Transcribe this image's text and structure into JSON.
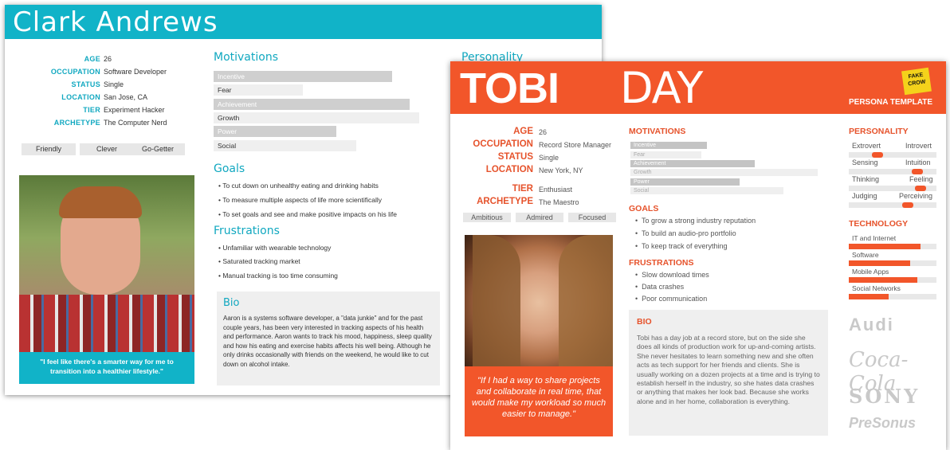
{
  "clark": {
    "name": "Clark Andrews",
    "details": [
      {
        "label": "AGE",
        "value": "26"
      },
      {
        "label": "OCCUPATION",
        "value": "Software Developer"
      },
      {
        "label": "STATUS",
        "value": "Single"
      },
      {
        "label": "LOCATION",
        "value": "San Jose, CA"
      },
      {
        "label": "TIER",
        "value": "Experiment Hacker"
      },
      {
        "label": "ARCHETYPE",
        "value": "The Computer Nerd"
      }
    ],
    "traits": [
      "Friendly",
      "Clever",
      "Go-Getter"
    ],
    "quote": "\"I feel like there's a smarter way for me to transition into a healthier lifestyle.\"",
    "motivations_title": "Motivations",
    "motivations": [
      {
        "label": "Incentive",
        "level": 0.8
      },
      {
        "label": "Fear",
        "level": 0.4
      },
      {
        "label": "Achievement",
        "level": 0.88
      },
      {
        "label": "Growth",
        "level": 0.92
      },
      {
        "label": "Power",
        "level": 0.55
      },
      {
        "label": "Social",
        "level": 0.64
      }
    ],
    "goals_title": "Goals",
    "goals": [
      "To cut down on unhealthy eating and drinking habits",
      "To measure multiple aspects of life more scientifically",
      "To set goals and see and make positive impacts on his life"
    ],
    "frustrations_title": "Frustrations",
    "frustrations": [
      "Unfamiliar with wearable technology",
      "Saturated tracking market",
      "Manual tracking is too time consuming"
    ],
    "bio_title": "Bio",
    "bio": "Aaron is a systems software developer, a \"data junkie\" and for the past couple years, has been very interested in tracking aspects of his health and performance. Aaron wants to track his mood, happiness, sleep quality and how his eating and exercise habits affects his well being. Although he only drinks occasionally with friends on the weekend, he would like to cut down on alcohol intake.",
    "personality_title": "Personality"
  },
  "tobi": {
    "first_name": "TOBI",
    "last_name": "DAY",
    "template_label": "PERSONA TEMPLATE",
    "badge": "FAKE CROW",
    "details": [
      {
        "label": "AGE",
        "value": "26"
      },
      {
        "label": "OCCUPATION",
        "value": "Record Store Manager"
      },
      {
        "label": "STATUS",
        "value": "Single"
      },
      {
        "label": "LOCATION",
        "value": "New York, NY"
      },
      {
        "label": "TIER",
        "value": "Enthusiast"
      },
      {
        "label": "ARCHETYPE",
        "value": "The Maestro"
      }
    ],
    "traits": [
      "Ambitious",
      "Admired",
      "Focused"
    ],
    "quote": "\"If I had a way to share projects and collaborate in real time, that would make my workload so much easier to manage.\"",
    "motivations_title": "MOTIVATIONS",
    "motivations": [
      {
        "label": "Incentive",
        "level": 0.4
      },
      {
        "label": "Fear",
        "level": 0.37
      },
      {
        "label": "Achievement",
        "level": 0.65
      },
      {
        "label": "Growth",
        "level": 0.98
      },
      {
        "label": "Power",
        "level": 0.57
      },
      {
        "label": "Social",
        "level": 0.8
      }
    ],
    "goals_title": "GOALS",
    "goals": [
      "To grow a strong industry reputation",
      "To build an audio-pro portfolio",
      "To keep track of everything"
    ],
    "frustrations_title": "FRUSTRATIONS",
    "frustrations": [
      "Slow download times",
      "Data crashes",
      "Poor communication"
    ],
    "bio_title": "BIO",
    "bio": "Tobi has a day job at a record store, but on the side she does all kinds of production work for up-and-coming artists.  She never hesitates to learn something new and she often acts as tech support for her friends and clients. She is usually working on a dozen projects at a time and is trying to establish herself in the industry, so she hates data crashes or anything that makes her look bad. Because she works alone and in her home, collaboration is everything.",
    "personality_title": "PERSONALITY",
    "personality": [
      {
        "left": "Extrovert",
        "right": "Introvert",
        "level": 0.3
      },
      {
        "left": "Sensing",
        "right": "Intuition",
        "level": 0.82
      },
      {
        "left": "Thinking",
        "right": "Feeling",
        "level": 0.86
      },
      {
        "left": "Judging",
        "right": "Perceiving",
        "level": 0.7
      }
    ],
    "technology_title": "TECHNOLOGY",
    "technology": [
      {
        "label": "IT and Internet",
        "level": 0.82
      },
      {
        "label": "Software",
        "level": 0.7
      },
      {
        "label": "Mobile Apps",
        "level": 0.78
      },
      {
        "label": "Social Networks",
        "level": 0.45
      }
    ],
    "brands": [
      "Audi",
      "Coca-Cola",
      "SONY",
      "PreSonus"
    ]
  }
}
